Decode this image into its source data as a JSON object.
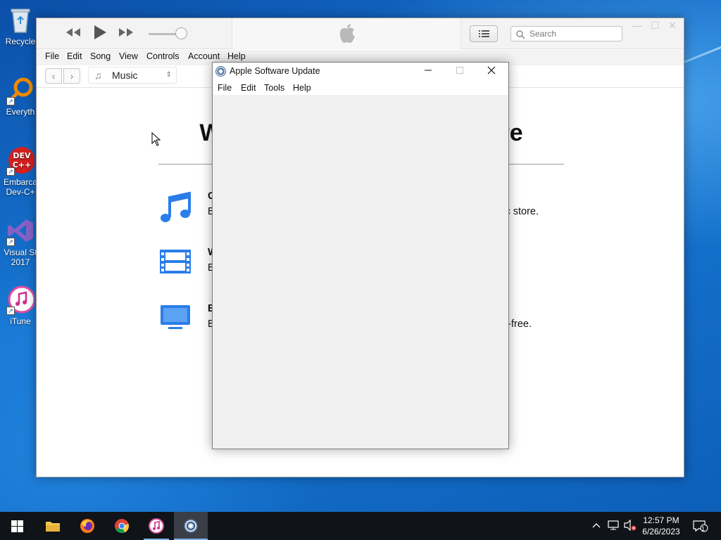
{
  "desktop": {
    "icons": [
      {
        "label": "Recycle",
        "icon": "recycle-bin-icon"
      },
      {
        "label": "Everyth",
        "icon": "everything-search-icon"
      },
      {
        "label": "Embarca",
        "label2": "Dev-C+",
        "icon": "devcpp-icon"
      },
      {
        "label": "Visual St",
        "label2": "2017",
        "icon": "visual-studio-icon"
      },
      {
        "label": "iTune",
        "icon": "itunes-icon"
      }
    ]
  },
  "itunes": {
    "search_placeholder": "Search",
    "menu": [
      "File",
      "Edit",
      "Song",
      "View",
      "Controls",
      "Account",
      "Help"
    ],
    "media_selector": "Music",
    "welcome_title_left": "W",
    "welcome_title_right": "re",
    "features": [
      {
        "title": "G",
        "desc_left": "B",
        "desc_right": "c store.",
        "icon": "music-note-icon"
      },
      {
        "title": "W",
        "desc_left": "B",
        "desc_right": ".",
        "icon": "film-strip-icon"
      },
      {
        "title": "E",
        "desc_left": "B",
        "desc_right": "-free.",
        "icon": "tv-icon"
      }
    ],
    "colors": {
      "accent": "#2b7de9"
    }
  },
  "dialog": {
    "title": "Apple Software Update",
    "menu": [
      "File",
      "Edit",
      "Tools",
      "Help"
    ]
  },
  "taskbar": {
    "apps": [
      "start",
      "file-explorer",
      "firefox",
      "chrome",
      "itunes",
      "apple-software-update"
    ],
    "time": "12:57 PM",
    "date": "6/26/2023",
    "notification_count": "1"
  }
}
